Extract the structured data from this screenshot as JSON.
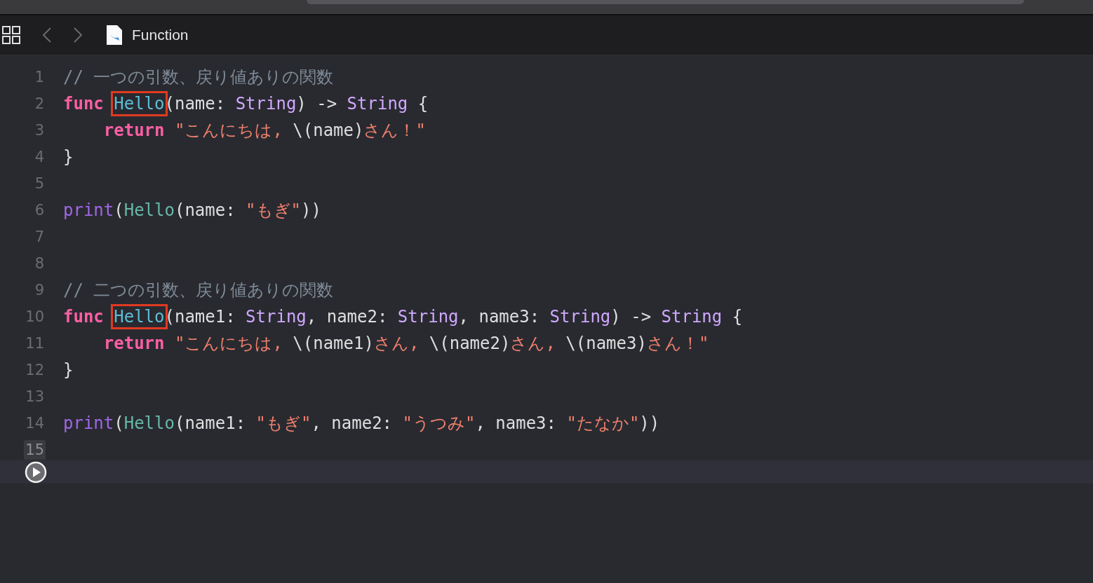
{
  "toolbar": {
    "title": "Function"
  },
  "lines": [
    {
      "number": "1",
      "current": false,
      "tokens": [
        {
          "kind": "comment",
          "text": "// 一つの引数、戻り値ありの関数"
        }
      ]
    },
    {
      "number": "2",
      "current": false,
      "tokens": [
        {
          "kind": "keyword",
          "text": "func "
        },
        {
          "kind": "declared-name",
          "text": "Hello"
        },
        {
          "kind": "plain",
          "text": "(name: "
        },
        {
          "kind": "type",
          "text": "String"
        },
        {
          "kind": "plain",
          "text": ") -> "
        },
        {
          "kind": "type",
          "text": "String"
        },
        {
          "kind": "plain",
          "text": " {"
        }
      ]
    },
    {
      "number": "3",
      "current": false,
      "tokens": [
        {
          "kind": "keyword",
          "text": "    return "
        },
        {
          "kind": "string",
          "text": "\"こんにちは, "
        },
        {
          "kind": "plain",
          "text": "\\(name)"
        },
        {
          "kind": "string",
          "text": "さん！\""
        }
      ]
    },
    {
      "number": "4",
      "current": false,
      "tokens": [
        {
          "kind": "plain",
          "text": "}"
        }
      ]
    },
    {
      "number": "5",
      "current": false
    },
    {
      "number": "6",
      "current": false,
      "tokens": [
        {
          "kind": "builtin",
          "text": "print"
        },
        {
          "kind": "plain",
          "text": "("
        },
        {
          "kind": "call",
          "text": "Hello"
        },
        {
          "kind": "plain",
          "text": "(name: "
        },
        {
          "kind": "string",
          "text": "\"もぎ\""
        },
        {
          "kind": "plain",
          "text": "))"
        }
      ]
    },
    {
      "number": "7",
      "current": false
    },
    {
      "number": "8",
      "current": false
    },
    {
      "number": "9",
      "current": false,
      "tokens": [
        {
          "kind": "comment",
          "text": "// 二つの引数、戻り値ありの関数"
        }
      ]
    },
    {
      "number": "10",
      "current": false,
      "tokens": [
        {
          "kind": "keyword",
          "text": "func "
        },
        {
          "kind": "declared-name",
          "text": "Hello"
        },
        {
          "kind": "plain",
          "text": "(name1: "
        },
        {
          "kind": "type",
          "text": "String"
        },
        {
          "kind": "plain",
          "text": ", name2: "
        },
        {
          "kind": "type",
          "text": "String"
        },
        {
          "kind": "plain",
          "text": ", name3: "
        },
        {
          "kind": "type",
          "text": "String"
        },
        {
          "kind": "plain",
          "text": ") -> "
        },
        {
          "kind": "type",
          "text": "String"
        },
        {
          "kind": "plain",
          "text": " {"
        }
      ]
    },
    {
      "number": "11",
      "current": false,
      "tokens": [
        {
          "kind": "keyword",
          "text": "    return "
        },
        {
          "kind": "string",
          "text": "\"こんにちは, "
        },
        {
          "kind": "plain",
          "text": "\\(name1)"
        },
        {
          "kind": "string",
          "text": "さん, "
        },
        {
          "kind": "plain",
          "text": "\\(name2)"
        },
        {
          "kind": "string",
          "text": "さん, "
        },
        {
          "kind": "plain",
          "text": "\\(name3)"
        },
        {
          "kind": "string",
          "text": "さん！\""
        }
      ]
    },
    {
      "number": "12",
      "current": false,
      "tokens": [
        {
          "kind": "plain",
          "text": "}"
        }
      ]
    },
    {
      "number": "13",
      "current": false
    },
    {
      "number": "14",
      "current": false,
      "tokens": [
        {
          "kind": "builtin",
          "text": "print"
        },
        {
          "kind": "plain",
          "text": "("
        },
        {
          "kind": "call",
          "text": "Hello"
        },
        {
          "kind": "plain",
          "text": "(name1: "
        },
        {
          "kind": "string",
          "text": "\"もぎ\""
        },
        {
          "kind": "plain",
          "text": ", name2: "
        },
        {
          "kind": "string",
          "text": "\"うつみ\""
        },
        {
          "kind": "plain",
          "text": ", name3: "
        },
        {
          "kind": "string",
          "text": "\"たなか\""
        },
        {
          "kind": "plain",
          "text": "))"
        }
      ]
    },
    {
      "number": "15",
      "current": true
    }
  ]
}
